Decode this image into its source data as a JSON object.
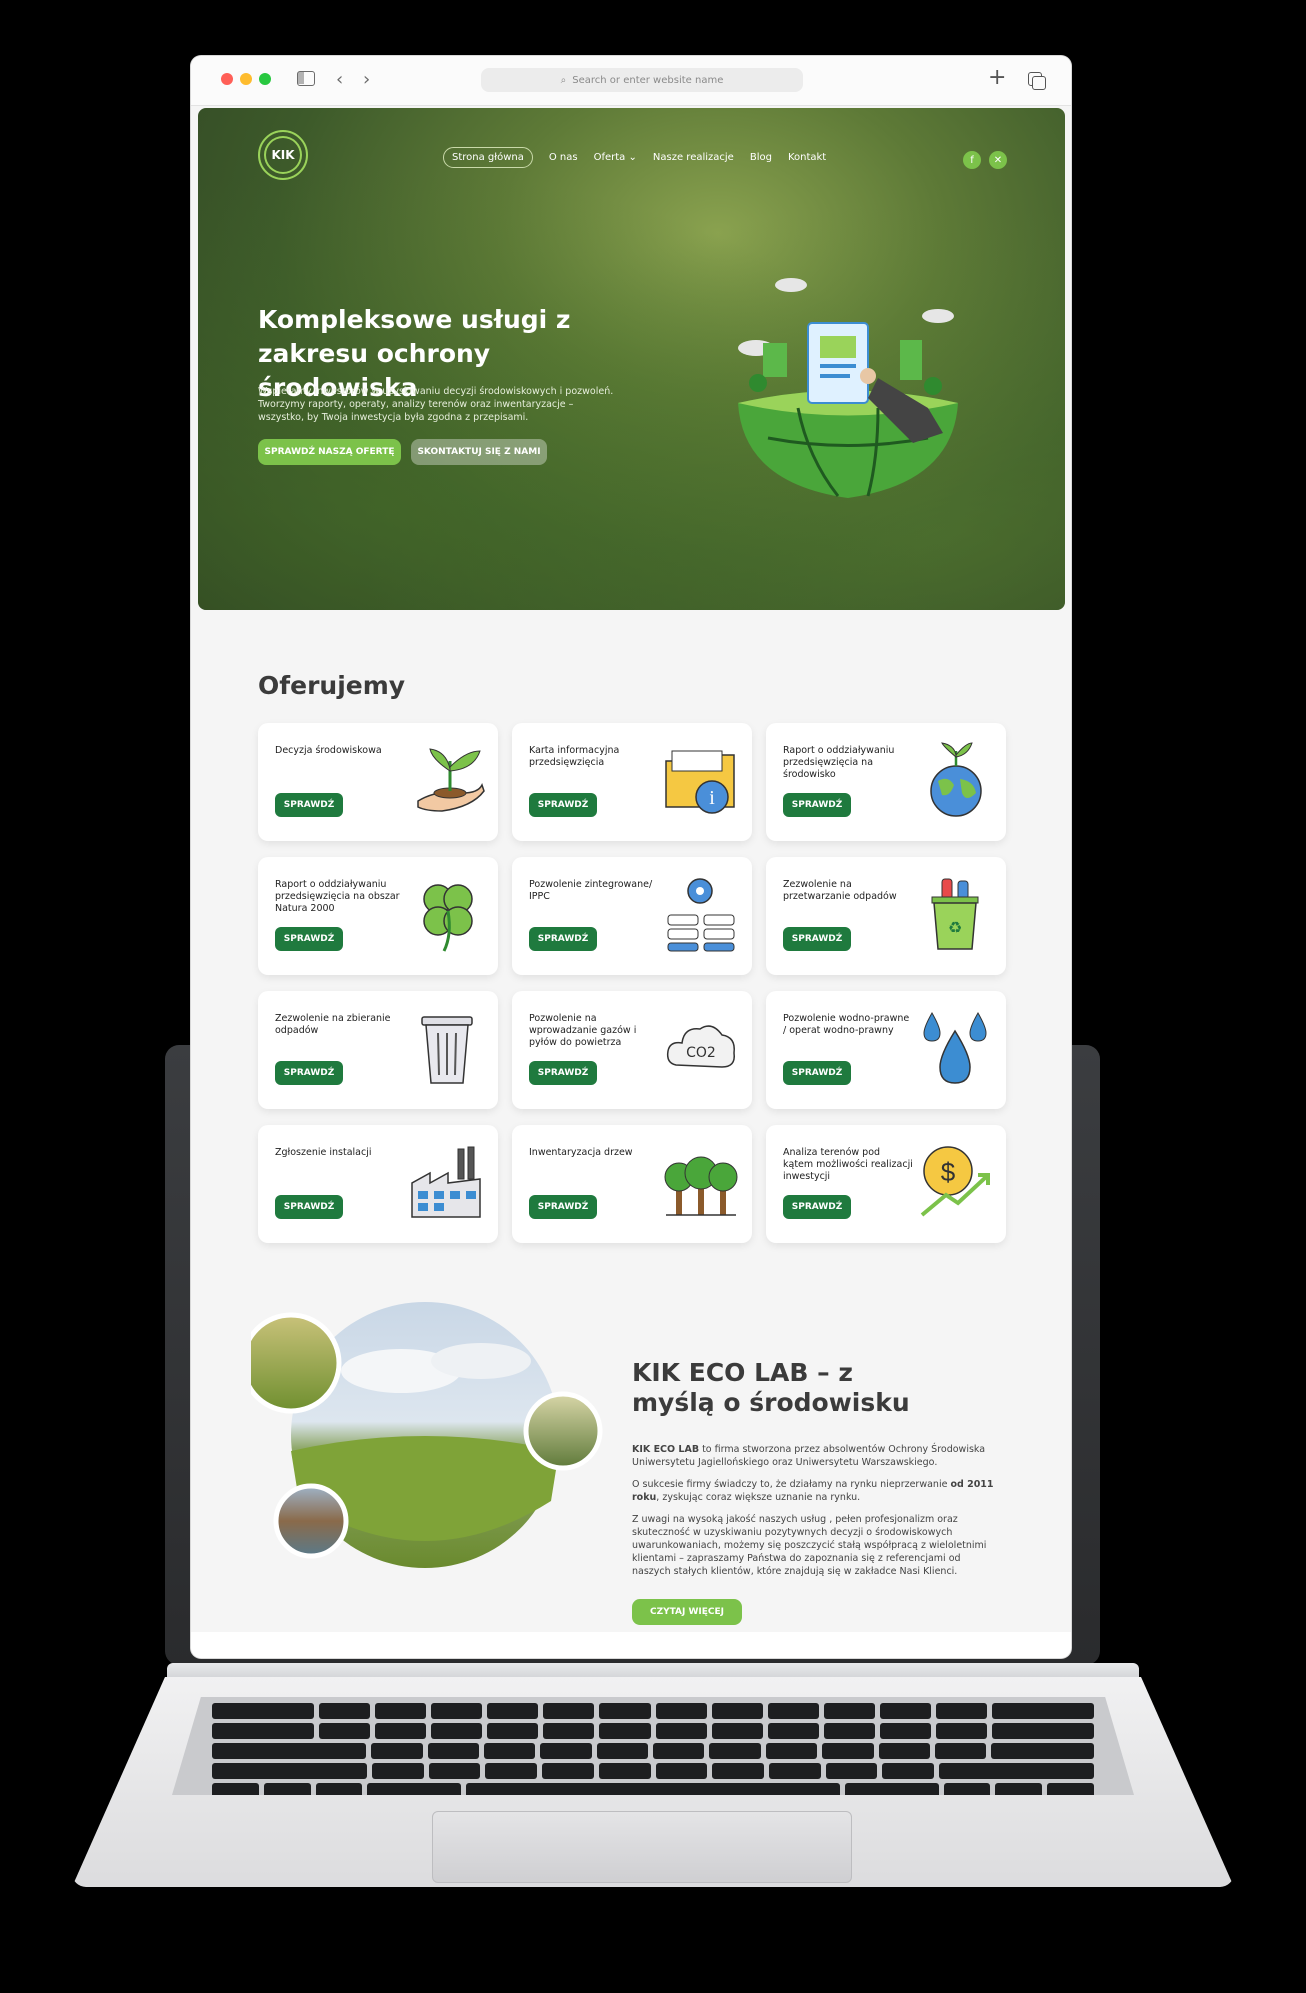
{
  "browser": {
    "address_placeholder": "Search or enter website name"
  },
  "site": {
    "logo_text": "KIK",
    "nav": [
      "Strona główna",
      "O nas",
      "Oferta",
      "Nasze realizacje",
      "Blog",
      "Kontakt"
    ],
    "social": [
      "facebook-icon",
      "x-icon"
    ]
  },
  "hero": {
    "title": "Kompleksowe usługi z zakresu ochrony środowiska",
    "description": "Wspieramy inwestorów w uzyskiwaniu decyzji środowiskowych i pozwoleń. Tworzymy raporty, operaty, analizy terenów oraz inwentaryzacje – wszystko, by Twoja inwestycja była zgodna z przepisami.",
    "primary_button": "SPRAWDŹ NASZĄ OFERTĘ",
    "secondary_button": "SKONTAKTUJ SIĘ Z NAMI"
  },
  "offers": {
    "title": "Oferujemy",
    "button_label": "SPRAWDŹ",
    "items": [
      {
        "title": "Decyzja środowiskowa",
        "icon": "plant-hand-icon"
      },
      {
        "title": "Karta informacyjna przedsięwzięcia",
        "icon": "info-folder-icon"
      },
      {
        "title": "Raport o oddziaływaniu przedsięwzięcia na środowisko",
        "icon": "globe-sprout-icon"
      },
      {
        "title": "Raport o oddziaływaniu przedsięwzięcia na obszar Natura 2000",
        "icon": "clover-icon"
      },
      {
        "title": "Pozwolenie zintegrowane/ IPPC",
        "icon": "server-gear-icon"
      },
      {
        "title": "Zezwolenie na przetwarzanie odpadów",
        "icon": "recycle-bin-icon"
      },
      {
        "title": "Zezwolenie na zbieranie odpadów",
        "icon": "trash-can-icon"
      },
      {
        "title": "Pozwolenie na wprowadzanie gazów i pyłów do powietrza",
        "icon": "co2-cloud-icon"
      },
      {
        "title": "Pozwolenie wodno-prawne / operat wodno-prawny",
        "icon": "water-drops-icon"
      },
      {
        "title": "Zgłoszenie instalacji",
        "icon": "factory-icon"
      },
      {
        "title": "Inwentaryzacja drzew",
        "icon": "trees-icon"
      },
      {
        "title": "Analiza terenów pod kątem możliwości realizacji inwestycji",
        "icon": "dollar-growth-icon"
      }
    ]
  },
  "about": {
    "title": "KIK ECO LAB – z myślą o środowisku",
    "p1_strong": "KIK ECO LAB",
    "p1": " to firma stworzona przez absolwentów Ochrony Środowiska Uniwersytetu Jagiellońskiego oraz Uniwersytetu Warszawskiego.",
    "p2_a": "O sukcesie firmy świadczy to, że działamy na rynku nieprzerwanie ",
    "p2_strong": "od 2011 roku",
    "p2_b": ", zyskując coraz większe uznanie na rynku.",
    "p3": "Z uwagi na wysoką jakość naszych usług , pełen profesjonalizm oraz skuteczność w uzyskiwaniu pozytywnych decyzji o środowiskowych uwarunkowaniach, możemy się poszczycić stałą współpracą z wieloletnimi klientami – zapraszamy Państwa do zapoznania się z referencjami od naszych stałych klientów, które znajdują się w zakładce Nasi Klienci.",
    "button": "CZYTAJ WIĘCEJ"
  },
  "colors": {
    "accent": "#7cc24a",
    "button_dark": "#1f7a3e",
    "hero_bg": "#3d5a2a"
  }
}
